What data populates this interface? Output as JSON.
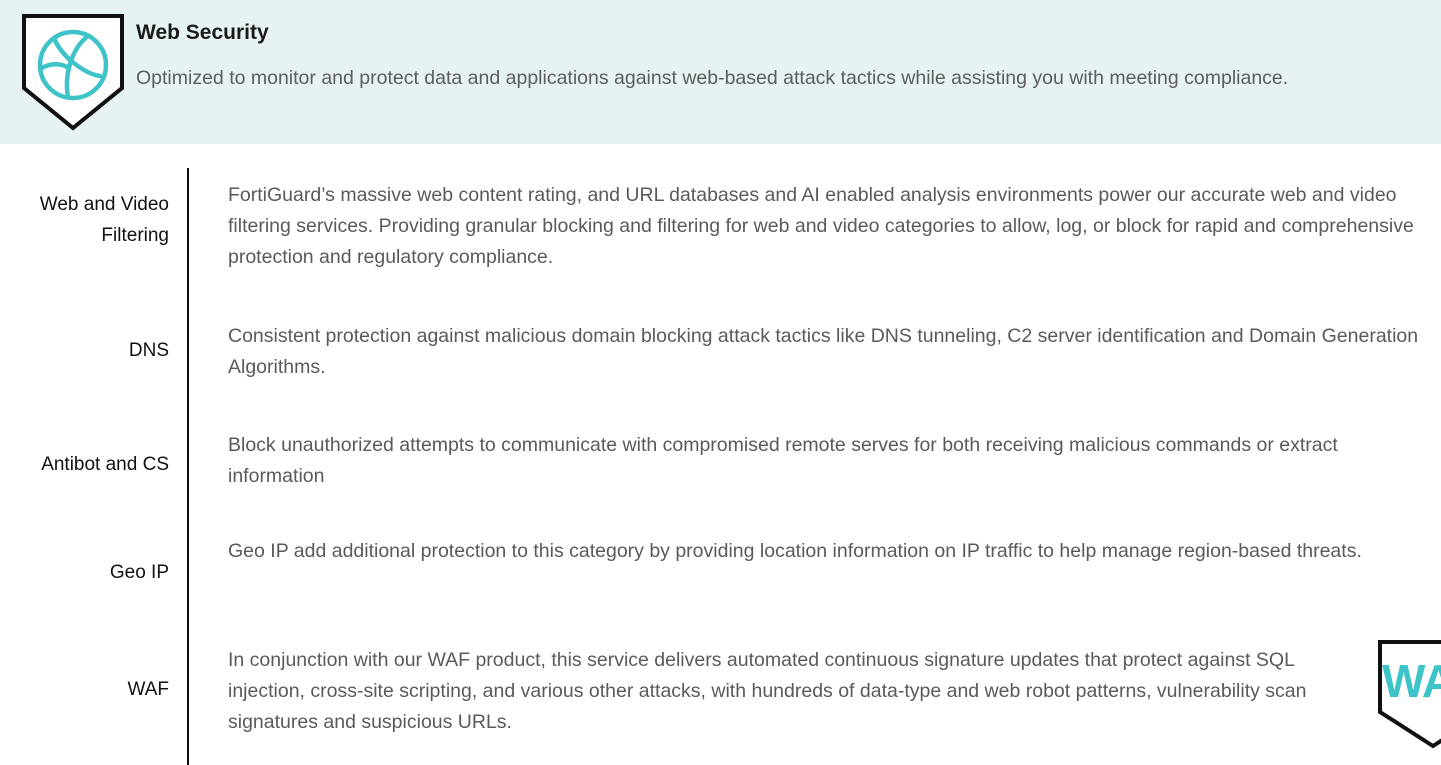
{
  "header": {
    "title": "Web Security",
    "description": "Optimized to monitor and protect data and applications against web-based attack tactics while assisting you with meeting compliance.",
    "icon": "globe-shield-icon",
    "accent_color": "#3ec3c9",
    "background_color": "#e7f2f5"
  },
  "services": [
    {
      "label_line1": "Web and Video",
      "label_line2": "Filtering",
      "description": "FortiGuard’s massive web content rating, and URL databases and AI enabled analysis environments power our accurate web and video filtering services. Providing granular blocking and filtering for web and video categories to allow, log, or block for rapid and comprehensive protection and regulatory compliance."
    },
    {
      "label": "DNS",
      "description": "Consistent protection against malicious domain blocking attack tactics like DNS tunneling, C2 server identification and Domain Generation Algorithms."
    },
    {
      "label": "Antibot and CS",
      "description": "Block unauthorized attempts to communicate with compromised remote serves for both receiving malicious commands or extract information"
    },
    {
      "label": "Geo IP",
      "description": "Geo IP add additional protection to this category by providing location information on IP traffic to help manage region-based threats."
    },
    {
      "label": "WAF",
      "description": "In conjunction with our WAF product, this service delivers automated continuous signature updates that protect against SQL injection, cross-site scripting, and various other attacks, with hundreds of data-type and web robot patterns, vulnerability scan signatures and suspicious URLs."
    }
  ],
  "waf_badge": {
    "text": "WAF",
    "icon": "waf-shield-icon"
  }
}
